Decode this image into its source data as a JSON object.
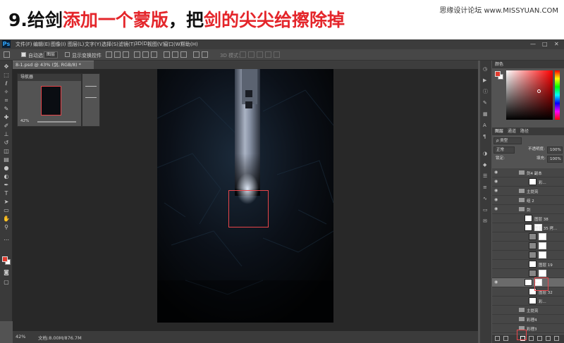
{
  "banner": {
    "step": "9.",
    "part1": "给剑",
    "part2": "添加一个蒙版",
    "part3": "，把",
    "part4": "剑的尖尖给擦除掉",
    "watermark": "思缘设计论坛 www.MISSYUAN.COM"
  },
  "menubar": {
    "logo": "Ps",
    "items": [
      "文件(F)",
      "编辑(E)",
      "图像(I)",
      "图层(L)",
      "文字(Y)",
      "选择(S)",
      "滤镜(T)",
      "3D(D)",
      "视图(V)",
      "窗口(W)",
      "帮助(H)"
    ],
    "minimize": "—",
    "maximize": "□",
    "close": "✕"
  },
  "optionsbar": {
    "auto_select": "自动选择：",
    "auto_select_value": "图层",
    "show_transform": "显示变换控件",
    "mode_3d": "3D 模式："
  },
  "document": {
    "tab_title": "8-1.psd @ 43% (剑, RGB/8) *"
  },
  "navigator": {
    "title": "导航器",
    "zoom": "42%"
  },
  "status": {
    "zoom": "42%",
    "doc_info": "文档:8.00M/876.7M"
  },
  "color_panel": {
    "title": "颜色",
    "fg_color": "#e23b2e",
    "bg_color": "#ffffff"
  },
  "layers_panel": {
    "tabs": [
      "图层",
      "通道",
      "路径"
    ],
    "kind_filter": "ρ 类型",
    "blend_mode": "正常",
    "opacity_label": "不透明度:",
    "opacity_value": "100%",
    "lock_label": "锁定:",
    "fill_label": "填充:",
    "fill_value": "100%",
    "layers": [
      {
        "name": "剑4 副本",
        "type": "group"
      },
      {
        "name": "彩...",
        "type": "layer"
      },
      {
        "name": "主提亮",
        "type": "group"
      },
      {
        "name": "组 2",
        "type": "group"
      },
      {
        "name": "剑",
        "type": "group"
      },
      {
        "name": "图层 38",
        "type": "layer"
      },
      {
        "name": "图层 35 拷...",
        "type": "layer"
      },
      {
        "name": "",
        "type": "adjust"
      },
      {
        "name": "",
        "type": "adjust"
      },
      {
        "name": "",
        "type": "adjust"
      },
      {
        "name": "图层 19",
        "type": "layer"
      },
      {
        "name": "",
        "type": "adjust"
      },
      {
        "name": "1...",
        "type": "layer"
      },
      {
        "name": "图层 32",
        "type": "layer"
      },
      {
        "name": "彩...",
        "type": "layer"
      },
      {
        "name": "主提亮",
        "type": "group"
      },
      {
        "name": "彩理4",
        "type": "group"
      },
      {
        "name": "彩理3",
        "type": "group"
      }
    ]
  },
  "accent": "#e4262b"
}
